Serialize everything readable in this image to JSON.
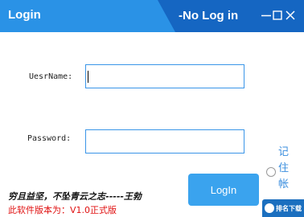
{
  "titlebar": {
    "title": "Login",
    "status": "-No Log in"
  },
  "form": {
    "username_label": "UesrName:",
    "username_value": "",
    "password_label": "Password:",
    "password_value": "",
    "login_label": "LogIn",
    "remember_label": "记住帐"
  },
  "footer": {
    "motto": "穷且益坚，不坠青云之志-----王勃",
    "version": "此软件版本为：V1.0正式版"
  },
  "watermark": {
    "text": "排名下载"
  },
  "colors": {
    "titlebar": "#2a92e6",
    "titlebar_dark": "#1566c2",
    "accent": "#3aa3ee",
    "version_text": "#e01010",
    "remember_text": "#3a8ede"
  },
  "icons": {
    "minimize": "minimize-icon",
    "maximize": "maximize-icon",
    "close": "close-icon"
  }
}
